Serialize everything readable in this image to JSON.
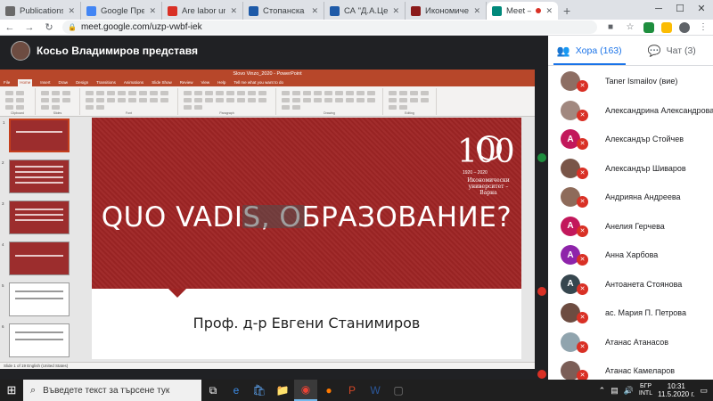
{
  "browser": {
    "tabs": [
      {
        "title": "Publications",
        "favicon_color": "#6a6a6a",
        "active": false
      },
      {
        "title": "Google Преводач",
        "favicon_color": "#4285f4",
        "active": false
      },
      {
        "title": "Are labor unions",
        "favicon_color": "#d93025",
        "active": false
      },
      {
        "title": "Стопанска академ",
        "favicon_color": "#1e5aa8",
        "active": false
      },
      {
        "title": "СА \"Д.А.Ценов\"",
        "favicon_color": "#1e5aa8",
        "active": false
      },
      {
        "title": "Икономическа",
        "favicon_color": "#8b1a1a",
        "active": false
      },
      {
        "title": "Meet – uzp-v",
        "favicon_color": "#00897b",
        "active": true
      }
    ],
    "new_tab_icon": "plus-icon",
    "url": "meet.google.com/uzp-vwbf-iek",
    "window_controls": {
      "minimize": "─",
      "maximize": "☐",
      "close": "✕"
    }
  },
  "meet": {
    "presenter_label": "Косьо Владимиров представя",
    "panel": {
      "people_tab_label": "Хора (163)",
      "chat_tab_label": "Чат (3)",
      "participants": [
        {
          "name": "Taner Ismailov (вие)",
          "initial": "",
          "color": "#8d6e63"
        },
        {
          "name": "Александрина Александрова",
          "initial": "",
          "color": "#a1887f"
        },
        {
          "name": "Александър Стойчев",
          "initial": "А",
          "color": "#c2185b"
        },
        {
          "name": "Александър Шиваров",
          "initial": "",
          "color": "#795548"
        },
        {
          "name": "Андрияна Андреева",
          "initial": "",
          "color": "#8e6b5a"
        },
        {
          "name": "Анелия Герчева",
          "initial": "А",
          "color": "#c2185b"
        },
        {
          "name": "Анна Харбова",
          "initial": "А",
          "color": "#8e24aa"
        },
        {
          "name": "Антоанета Стоянова",
          "initial": "А",
          "color": "#37474f"
        },
        {
          "name": "ас. Мария П. Петрова",
          "initial": "",
          "color": "#6d4c41"
        },
        {
          "name": "Атанас Атанасов",
          "initial": "",
          "color": "#90a4ae"
        },
        {
          "name": "Атанас Камеларов",
          "initial": "",
          "color": "#7b5e57"
        }
      ]
    }
  },
  "powerpoint": {
    "title_bar": "Slovo Vinzo_2020 - PowerPoint",
    "menu": [
      "File",
      "Home",
      "Insert",
      "Draw",
      "Design",
      "Transitions",
      "Animations",
      "Slide Show",
      "Review",
      "View",
      "Help"
    ],
    "tell_me": "Tell me what you want to do",
    "ribbon_groups": [
      "Clipboard",
      "Slides",
      "Font",
      "Paragraph",
      "Drawing",
      "Editing"
    ],
    "slide": {
      "title": "QUO VADIS, ОБРАЗОВАНИЕ?",
      "author": "Проф. д-р Евгени Станимиров",
      "logo_number": "100",
      "logo_years": "1920 – 2020",
      "logo_text": "Икономически университет – Варна"
    },
    "status": "Slide 1 of 19   English (United States)"
  },
  "taskbar": {
    "search_placeholder": "Въведете текст за търсене тук",
    "lang_top": "БГР",
    "lang_bottom": "INTL",
    "time": "10:31",
    "date": "11.5.2020 г."
  }
}
